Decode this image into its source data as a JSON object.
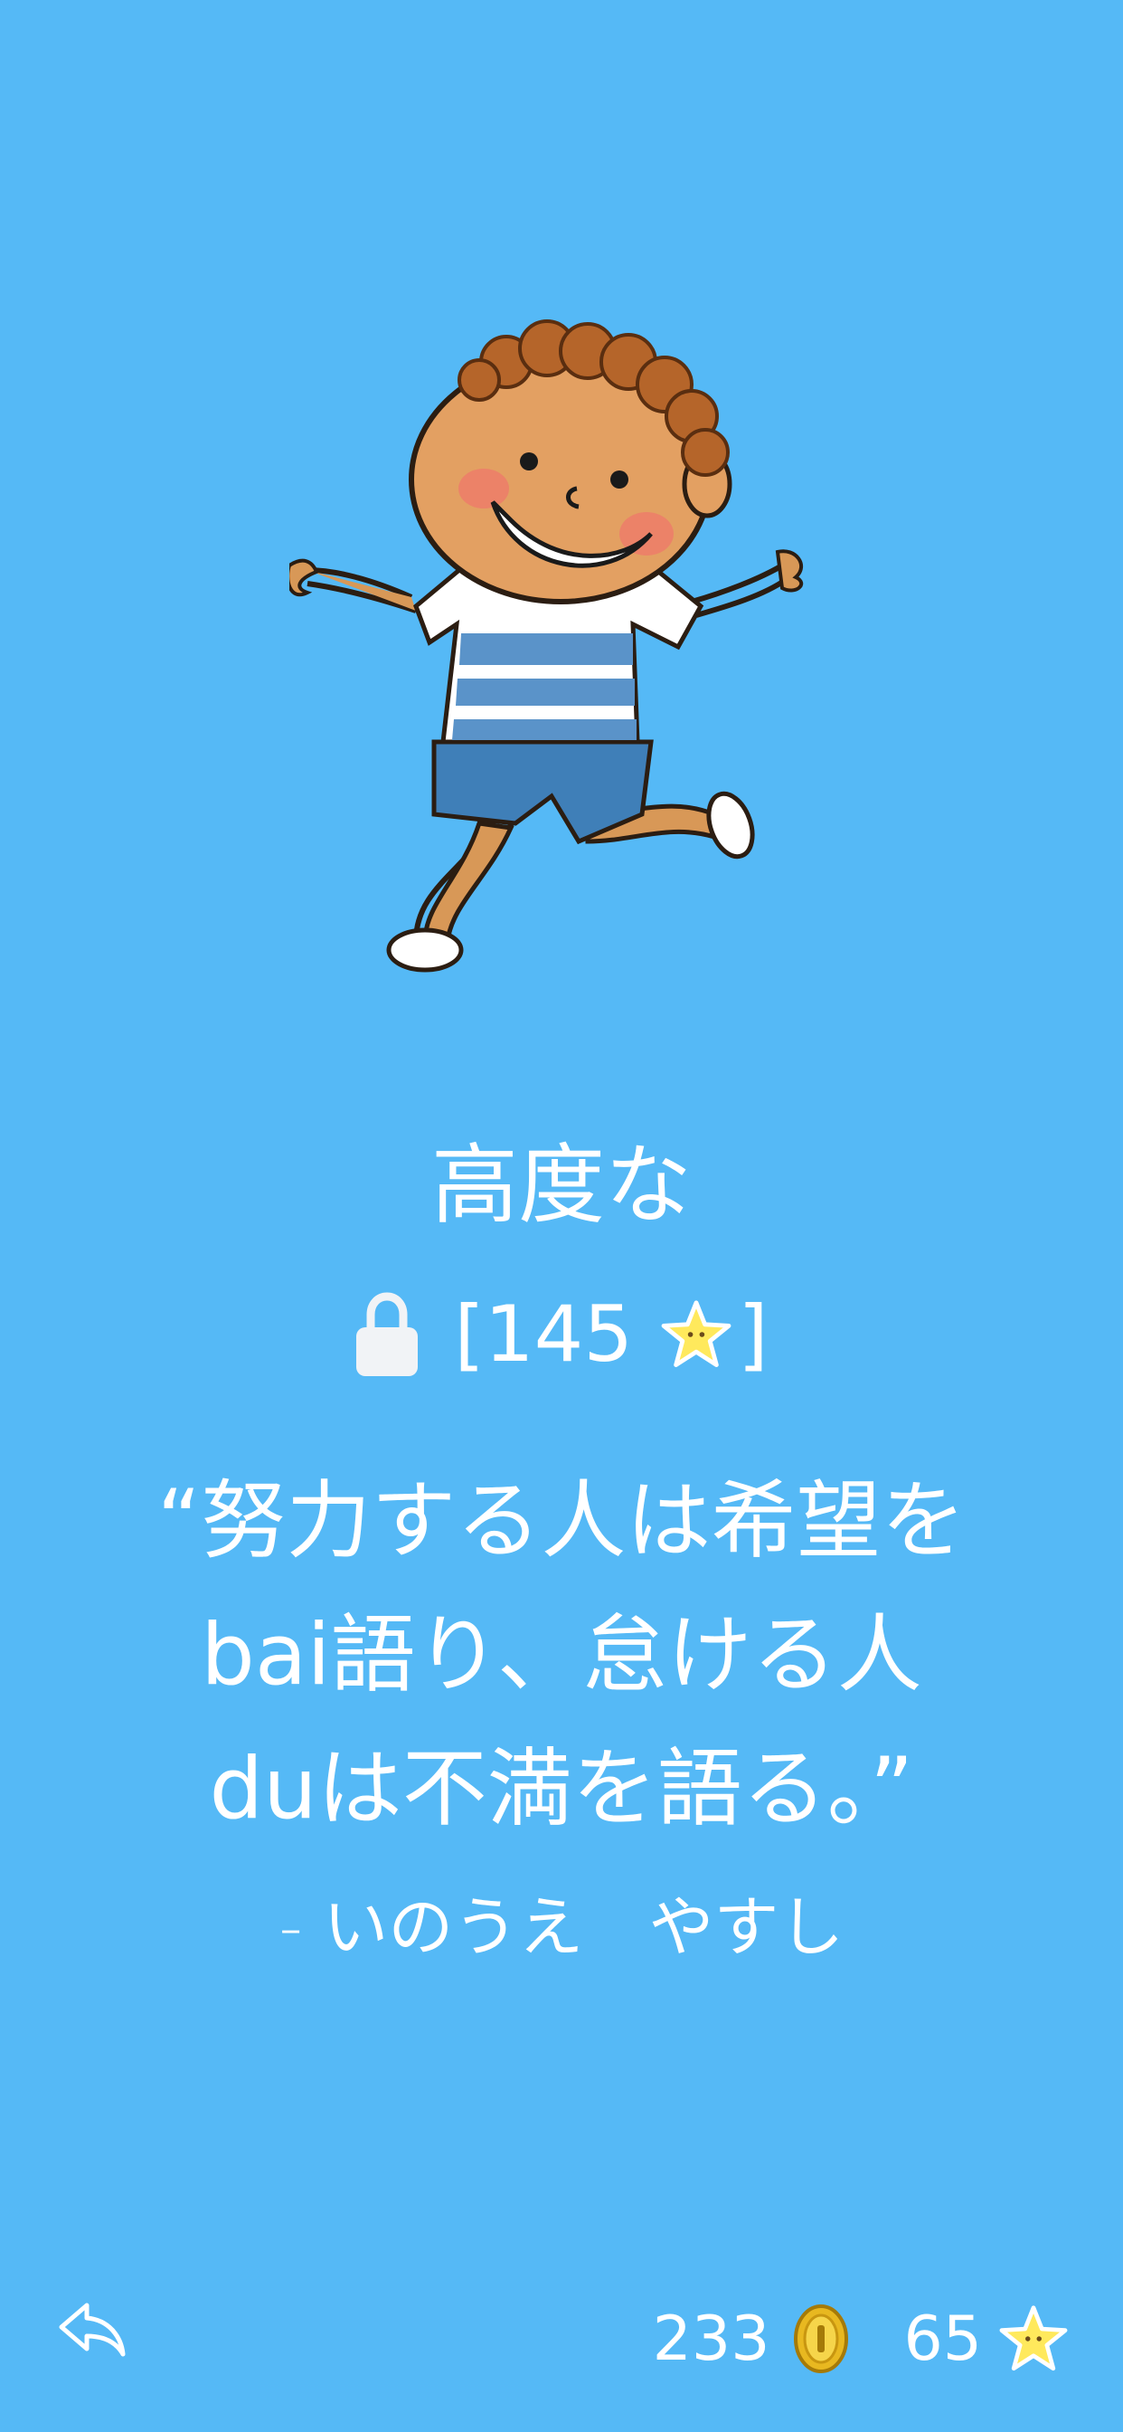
{
  "level": {
    "title": "高度な"
  },
  "lock": {
    "bracket_open": "[",
    "required_stars": "145",
    "bracket_close": "]"
  },
  "quote": {
    "line1": "“努力する人は希望を",
    "line2": "bai語り、怠ける人",
    "line3": "duは不満を語る。”",
    "author": "- いのうえ　やすし"
  },
  "stats": {
    "coins": "233",
    "stars": "65"
  },
  "icons": {
    "back": "back-arrow-icon",
    "lock": "lock-icon",
    "coin": "coin-icon",
    "star": "star-icon"
  },
  "colors": {
    "background": "#55b9f6",
    "text": "#ffffff",
    "star": "#ffe95c",
    "coin": "#e8b820"
  }
}
